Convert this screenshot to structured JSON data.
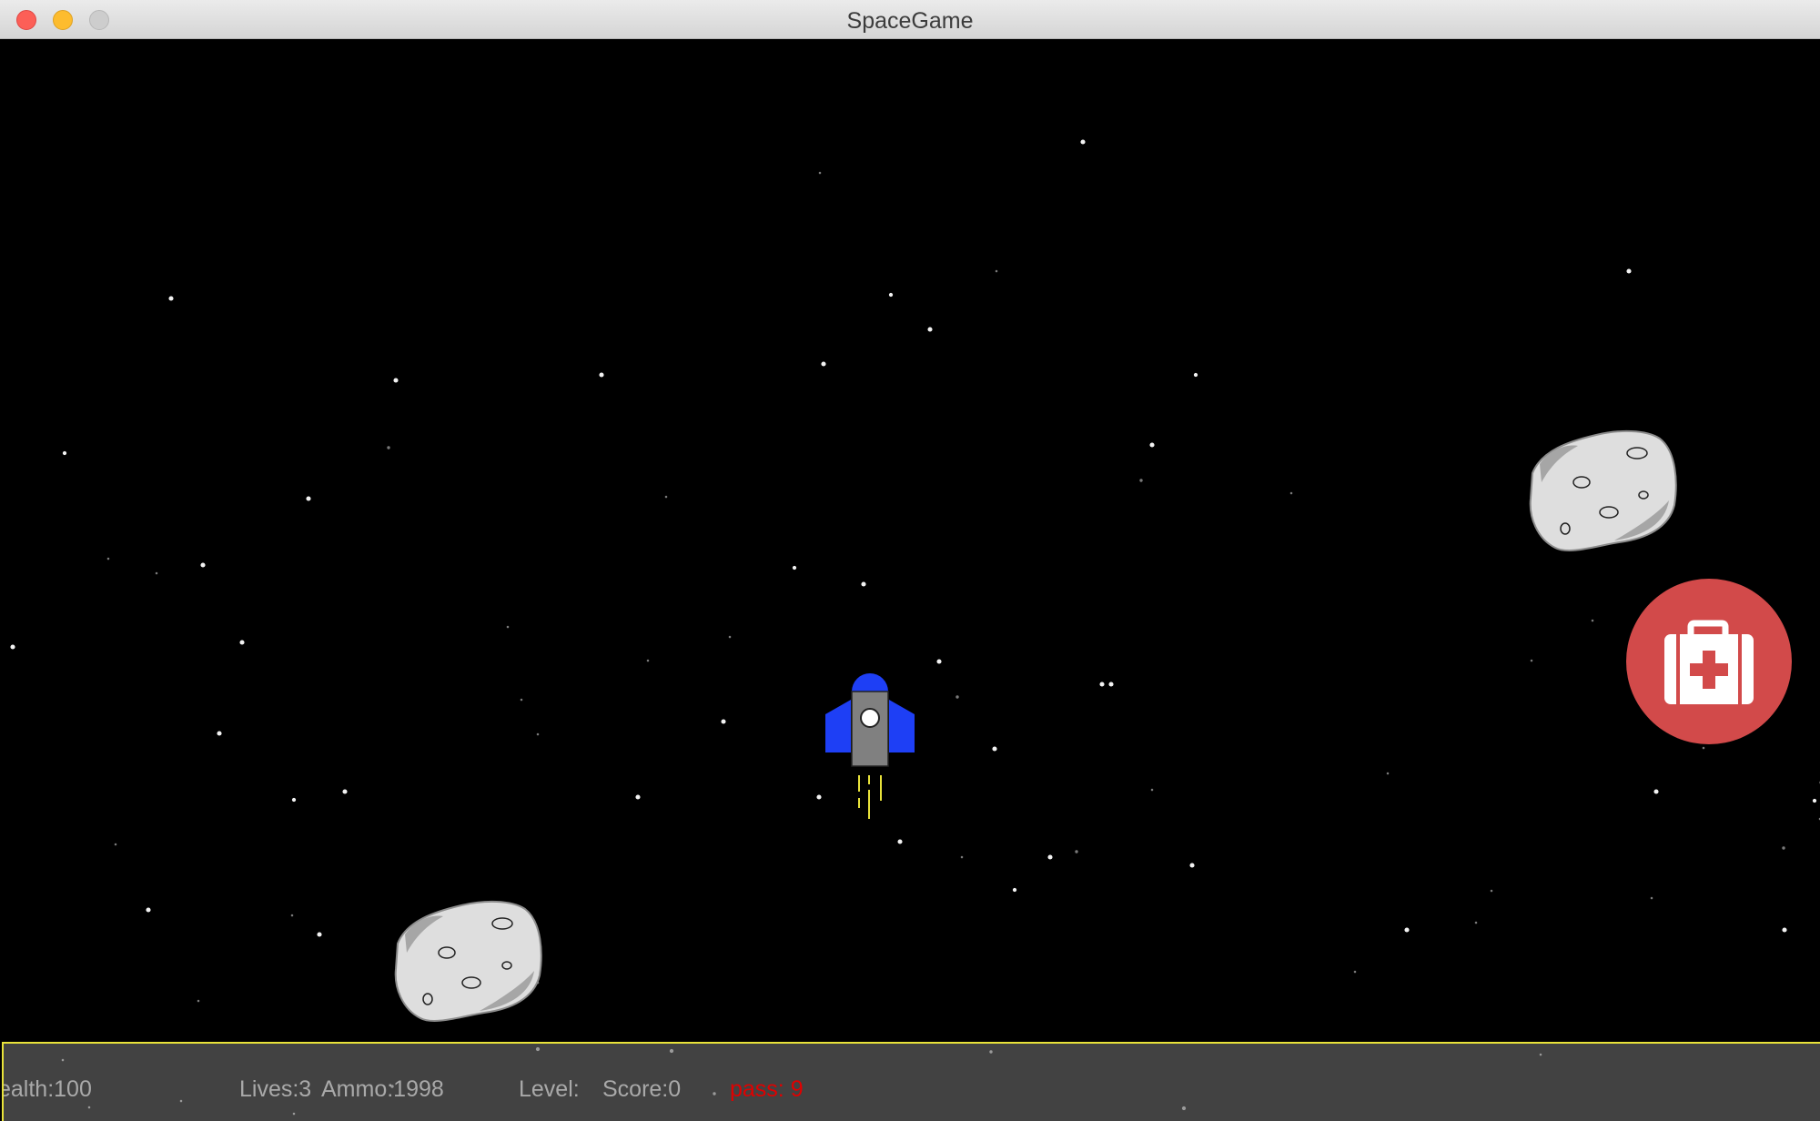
{
  "window": {
    "title": "SpaceGame"
  },
  "window_controls": {
    "close_icon": "close-icon",
    "minimize_icon": "minimize-icon",
    "zoom_icon": "zoom-icon"
  },
  "game": {
    "player_ship": "rocket-icon",
    "asteroids": [
      "asteroid",
      "asteroid"
    ],
    "powerup": "medkit-icon",
    "colors": {
      "background": "#000000",
      "ship_body": "#808080",
      "ship_wings": "#1e3ff5",
      "thrust": "#e8e23a",
      "medkit": "#d24a4a",
      "asteroid": "#dedede",
      "hud_background": "#424242",
      "hud_border": "#e8e23a",
      "pass_text": "#e00000"
    }
  },
  "hud": {
    "health": "ealth:100",
    "lives": "Lives:3",
    "ammo": "Ammo:1998",
    "level": "Level:",
    "score": "Score:0",
    "pass": "pass: 9"
  }
}
